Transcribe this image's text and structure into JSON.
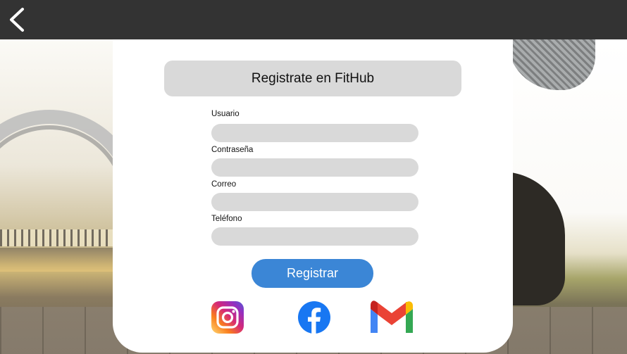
{
  "header": {
    "back_icon": "chevron-left-icon"
  },
  "form": {
    "title": "Registrate en FitHub",
    "fields": [
      {
        "label": "Usuario",
        "value": "",
        "placeholder": ""
      },
      {
        "label": "Contraseña",
        "value": "",
        "placeholder": ""
      },
      {
        "label": "Correo",
        "value": "",
        "placeholder": ""
      },
      {
        "label": "Teléfono",
        "value": "",
        "placeholder": ""
      }
    ],
    "submit_label": "Registrar"
  },
  "social": [
    {
      "icon": "instagram-icon"
    },
    {
      "icon": "facebook-icon"
    },
    {
      "icon": "gmail-icon"
    }
  ],
  "colors": {
    "topbar": "#333333",
    "input_bg": "#d9d9d9",
    "button": "#3b86d6",
    "facebook": "#1877f2"
  }
}
